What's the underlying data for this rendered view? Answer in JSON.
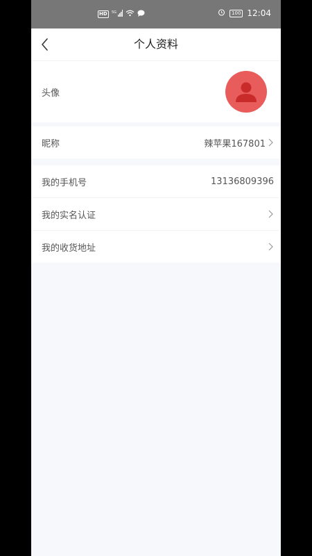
{
  "status_bar": {
    "left_indicators": "HD 5G",
    "time": "12:04",
    "battery": "100"
  },
  "header": {
    "title": "个人资料"
  },
  "profile": {
    "avatar_label": "头像",
    "nickname_label": "昵称",
    "nickname_value": "辣苹果167801"
  },
  "account": {
    "phone_label": "我的手机号",
    "phone_value": "13136809396",
    "realname_label": "我的实名认证",
    "address_label": "我的收货地址"
  },
  "colors": {
    "avatar_bg": "#e85c5c",
    "status_bar_bg": "#777777",
    "page_bg": "#f7f8fc"
  }
}
